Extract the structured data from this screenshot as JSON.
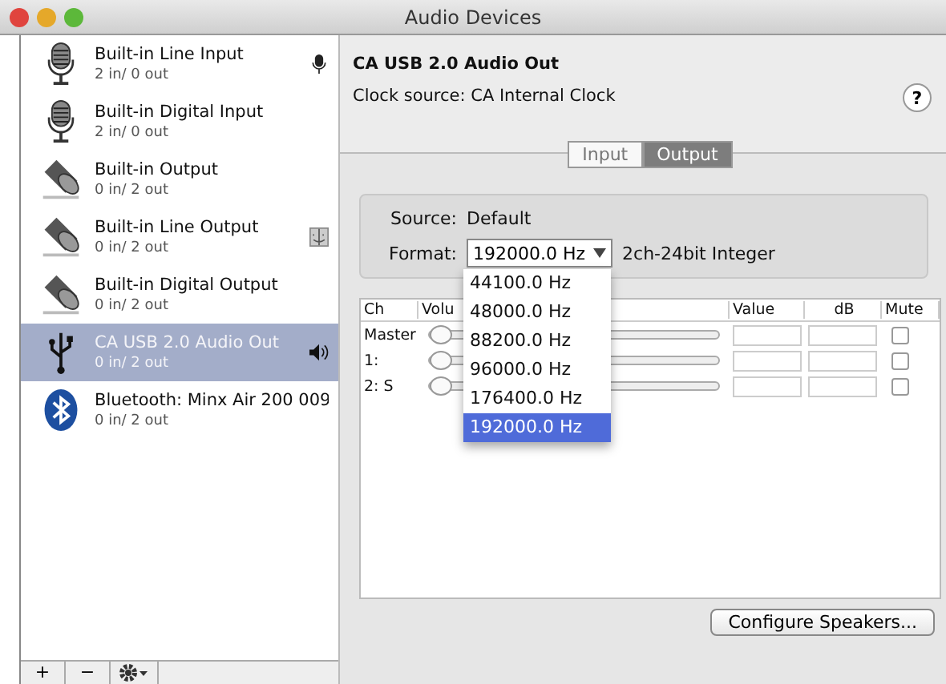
{
  "window": {
    "title": "Audio Devices"
  },
  "devices": [
    {
      "name": "Built-in Line Input",
      "io": "2 in/ 0 out",
      "kind": "mic",
      "badge": {
        "kind": "mic"
      },
      "selected": false
    },
    {
      "name": "Built-in Digital Input",
      "io": "2 in/ 0 out",
      "kind": "mic",
      "selected": false
    },
    {
      "name": "Built-in Output",
      "io": "0 in/ 2 out",
      "kind": "speaker",
      "selected": false
    },
    {
      "name": "Built-in Line Output",
      "io": "0 in/ 2 out",
      "kind": "speaker",
      "badge": {
        "kind": "finder"
      },
      "selected": false
    },
    {
      "name": "Built-in Digital Output",
      "io": "0 in/ 2 out",
      "kind": "speaker",
      "selected": false
    },
    {
      "name": "CA USB 2.0 Audio Out",
      "io": "0 in/ 2 out",
      "kind": "usb",
      "badge": {
        "kind": "speaker"
      },
      "selected": true
    },
    {
      "name": "Bluetooth: Minx Air 200 009",
      "io": "0 in/ 2 out",
      "kind": "bluetooth",
      "selected": false
    }
  ],
  "sidebar_toolbar": {
    "add": "+",
    "remove": "−"
  },
  "detail": {
    "device_name": "CA USB 2.0 Audio Out",
    "clock_source": "Clock source: CA Internal Clock",
    "help": "?"
  },
  "tabs": [
    {
      "label": "Input",
      "selected": false
    },
    {
      "label": "Output",
      "selected": true
    }
  ],
  "source": {
    "label": "Source:",
    "value": "Default"
  },
  "format": {
    "label": "Format:",
    "value": "192000.0 Hz",
    "description": "2ch-24bit Integer"
  },
  "dropdown": {
    "options": [
      {
        "label": "44100.0 Hz",
        "selected": false
      },
      {
        "label": "48000.0 Hz",
        "selected": false
      },
      {
        "label": "88200.0 Hz",
        "selected": false
      },
      {
        "label": "96000.0 Hz",
        "selected": false
      },
      {
        "label": "176400.0 Hz",
        "selected": false
      },
      {
        "label": "192000.0 Hz",
        "selected": true
      }
    ]
  },
  "table": {
    "columns": [
      "Ch",
      "Volu",
      "Value",
      "dB",
      "Mute"
    ],
    "rows": [
      {
        "ch": "Master",
        "level": 0,
        "mute": false
      },
      {
        "ch": "1:",
        "level": 0,
        "mute": false
      },
      {
        "ch": "2: S",
        "level": 0,
        "mute": false
      }
    ]
  },
  "buttons": [
    "Configure Speakers..."
  ]
}
